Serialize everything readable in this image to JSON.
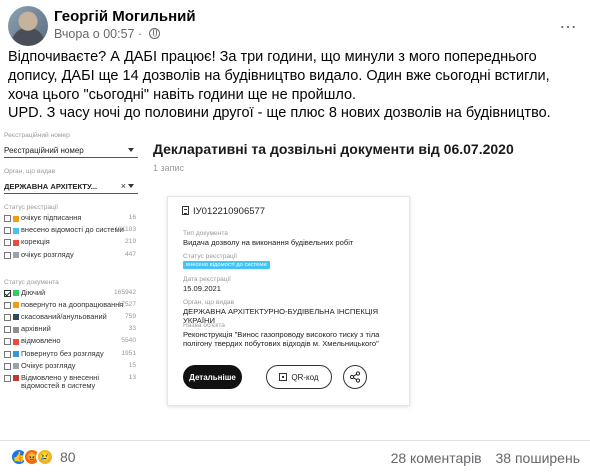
{
  "post": {
    "author": "Георгій Могильний",
    "time": "Вчора о 00:57",
    "more_icon": "…",
    "paragraphs": [
      "Відпочиваєте? А ДАБІ працює! За три години, що минули з мого попереднього допису, ДАБІ ще 14 дозволів на будівництво видало. Один вже сьогодні встигли, хоча цього \"сьогодні\" навіть години ще не пройшло.",
      "UPD. З часу ночі до половини другої - ще плюс 8 нових дозволів на будівництво."
    ]
  },
  "filters": {
    "registry_number_label": "Реєстраційний номер",
    "registry_number_value": "Реєстраційний номер",
    "issuer_label": "Орган, що видав",
    "issuer_value": "ДЕРЖАВНА АРХІТЕКТУ...",
    "registry_status_label": "Статус реєстрації",
    "registry_status": [
      {
        "label": "очікує підписання",
        "count": "16",
        "color": "#f39c12",
        "checked": false
      },
      {
        "label": "внесено відомості до системи",
        "count": "191103",
        "color": "#42c3f7",
        "checked": false
      },
      {
        "label": "корекція",
        "count": "219",
        "color": "#e74c3c",
        "checked": false
      },
      {
        "label": "очікує розгляду",
        "count": "447",
        "color": "#9aa3ad",
        "checked": false
      }
    ],
    "doc_status_label": "Статус документа",
    "doc_status": [
      {
        "label": "Діючий",
        "count": "165942",
        "color": "#2ecc71",
        "checked": true
      },
      {
        "label": "повернуто на доопрацювання",
        "count": "17527",
        "color": "#f39c12",
        "checked": false
      },
      {
        "label": "скасований/анульований",
        "count": "759",
        "color": "#34495e",
        "checked": false
      },
      {
        "label": "архівний",
        "count": "33",
        "color": "#8e8e8e",
        "checked": false
      },
      {
        "label": "відмовлено",
        "count": "5540",
        "color": "#e74c3c",
        "checked": false
      },
      {
        "label": "Повернуто без розгляду",
        "count": "1951",
        "color": "#3498db",
        "checked": false
      },
      {
        "label": "Очікує розгляду",
        "count": "15",
        "color": "#9aa3ad",
        "checked": false
      },
      {
        "label": "Відмовлено у внесенні відомостей в систему",
        "count": "13",
        "color": "#c0392b",
        "checked": false
      }
    ]
  },
  "main": {
    "title": "Декларативні та дозвільні документи від 06.07.2020",
    "count": "1 запис"
  },
  "card": {
    "id": "ІУ012210906577",
    "type_label": "Тип документа",
    "type_value": "Видача дозволу на виконання будівельних робіт",
    "status_label": "Статус реєстрації",
    "status_badge": "внесено відомості до системи",
    "date_label": "Дата реєстрації",
    "date_value": "15.09.2021",
    "issuer_label": "Орган, що видав",
    "issuer_value": "ДЕРЖАВНА АРХІТЕКТУРНО-БУДІВЕЛЬНА ІНСПЕКЦІЯ УКРАЇНИ",
    "object_label": "Назва об'єкта",
    "object_value": "Реконструкція \"Винос газопроводу високого тиску з тіла полігону твердих побутових відходів м. Хмельницького\"",
    "details_button": "Детальніше",
    "qr_button": "QR-код"
  },
  "footer": {
    "reactions_count": "80",
    "comments": "28 коментарів",
    "shares": "38 поширень"
  }
}
